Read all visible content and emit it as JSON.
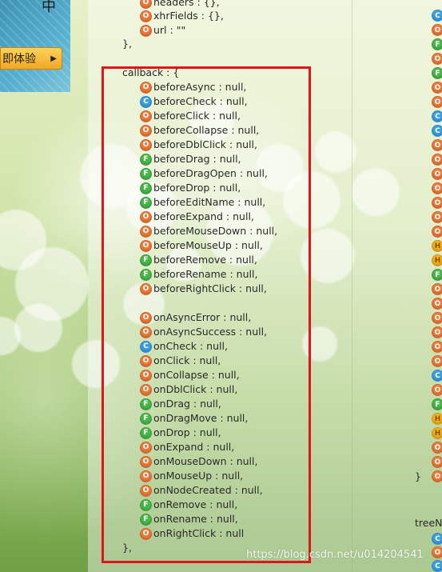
{
  "banner": {
    "title": "中",
    "try_button": "即体验",
    "try_arrow": "▶"
  },
  "code": {
    "top_lines": [
      {
        "badge": "O",
        "text": "headers : {},"
      },
      {
        "badge": "O",
        "text": "xhrFields : {},"
      },
      {
        "badge": "O",
        "text": "url : \"\""
      }
    ],
    "async_close": "},",
    "callback_open": "callback : {",
    "before_items": [
      {
        "badge": "O",
        "text": "beforeAsync : null,"
      },
      {
        "badge": "C",
        "text": "beforeCheck : null,"
      },
      {
        "badge": "O",
        "text": "beforeClick : null,"
      },
      {
        "badge": "O",
        "text": "beforeCollapse : null,"
      },
      {
        "badge": "O",
        "text": "beforeDblClick : null,"
      },
      {
        "badge": "F",
        "text": "beforeDrag : null,"
      },
      {
        "badge": "F",
        "text": "beforeDragOpen : null,"
      },
      {
        "badge": "F",
        "text": "beforeDrop : null,"
      },
      {
        "badge": "F",
        "text": "beforeEditName : null,"
      },
      {
        "badge": "O",
        "text": "beforeExpand : null,"
      },
      {
        "badge": "O",
        "text": "beforeMouseDown : null,"
      },
      {
        "badge": "O",
        "text": "beforeMouseUp : null,"
      },
      {
        "badge": "F",
        "text": "beforeRemove : null,"
      },
      {
        "badge": "F",
        "text": "beforeRename : null,"
      },
      {
        "badge": "O",
        "text": "beforeRightClick : null,"
      }
    ],
    "on_items": [
      {
        "badge": "O",
        "text": "onAsyncError : null,"
      },
      {
        "badge": "O",
        "text": "onAsyncSuccess : null,"
      },
      {
        "badge": "C",
        "text": "onCheck : null,"
      },
      {
        "badge": "O",
        "text": "onClick : null,"
      },
      {
        "badge": "O",
        "text": "onCollapse : null,"
      },
      {
        "badge": "O",
        "text": "onDblClick : null,"
      },
      {
        "badge": "F",
        "text": "onDrag : null,"
      },
      {
        "badge": "F",
        "text": "onDragMove : null,"
      },
      {
        "badge": "F",
        "text": "onDrop : null,"
      },
      {
        "badge": "O",
        "text": "onExpand : null,"
      },
      {
        "badge": "O",
        "text": "onMouseDown : null,"
      },
      {
        "badge": "O",
        "text": "onMouseUp : null,"
      },
      {
        "badge": "O",
        "text": "onNodeCreated : null,"
      },
      {
        "badge": "F",
        "text": "onRemove : null,"
      },
      {
        "badge": "F",
        "text": "onRename : null,"
      },
      {
        "badge": "O",
        "text": "onRightClick : null"
      }
    ],
    "callback_close": "},"
  },
  "right_column": {
    "badges": [
      "C",
      "O",
      "F",
      "O",
      "F",
      "O",
      "O",
      "C",
      "C",
      "O",
      "O",
      "O",
      "O",
      "O",
      "O",
      "O",
      "H",
      "H",
      "F",
      "O",
      "O",
      "O",
      "O",
      "O",
      "O",
      "C",
      "O",
      "F",
      "H",
      "H",
      "O",
      "O",
      "O"
    ],
    "brace_close": "}",
    "tree_label": "treeN",
    "tree_badges": [
      "C",
      "O",
      "C"
    ]
  },
  "watermark": "https://blog.csdn.net/u014204541",
  "badge_letters": {
    "O": "O",
    "C": "C",
    "F": "F",
    "H": "H"
  },
  "colors": {
    "selection_border": "#e0141b",
    "badge_orange": "#ef7a3a",
    "badge_blue": "#3aa0e6",
    "badge_green": "#49b84a",
    "badge_yellow": "#f2b21c"
  }
}
